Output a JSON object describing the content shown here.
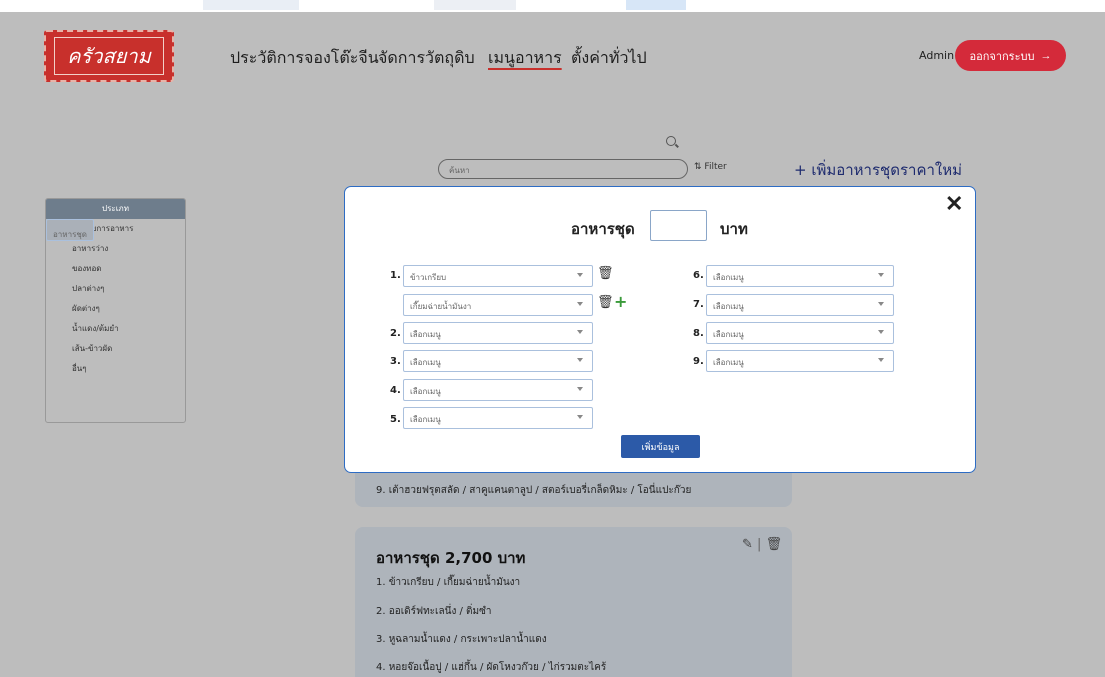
{
  "header": {
    "logo_text": "ครัวสยาม",
    "nav": [
      "ประวัติการจองโต๊ะจีน",
      "จัดการวัตถุดิบ",
      "เมนูอาหาร",
      "ตั้งค่าทั่วไป"
    ],
    "admin_label": "Admin",
    "logout_label": "ออกจากระบบ",
    "logout_arrow": "→"
  },
  "search": {
    "placeholder": "ค้นหา",
    "filter_label": "Filter",
    "filter_icon": "⇅"
  },
  "add_set_label": "+ เพิ่มอาหารชุดราคาใหม่",
  "sidebar": {
    "header": "ประเภท",
    "items": [
      "อาหารชุด",
      "ประเภทรายการอาหาร",
      "อาหารว่าง",
      "ของทอด",
      "ปลาต่างๆ",
      "ผัดต่างๆ",
      "น้ำแดง/ต้มยำ",
      "เส้น-ข้าวผัด",
      "อื่นๆ"
    ]
  },
  "modal": {
    "title": "อาหารชุด",
    "unit": "บาท",
    "close_icon": "✕",
    "left_rows": [
      {
        "num": "1.",
        "value": "ข้าวเกรียบ"
      },
      {
        "num": "",
        "value": "เกี๊ยมฉ่ายน้ำมันงา"
      },
      {
        "num": "2.",
        "value": "เลือกเมนู"
      },
      {
        "num": "3.",
        "value": "เลือกเมนู"
      },
      {
        "num": "4.",
        "value": "เลือกเมนู"
      },
      {
        "num": "5.",
        "value": "เลือกเมนู"
      }
    ],
    "right_rows": [
      {
        "num": "6.",
        "value": "เลือกเมนู"
      },
      {
        "num": "7.",
        "value": "เลือกเมนู"
      },
      {
        "num": "8.",
        "value": "เลือกเมนู"
      },
      {
        "num": "9.",
        "value": "เลือกเมนู"
      }
    ],
    "trash_icon": "🗑",
    "plus_icon": "+",
    "submit_label": "เพิ่มข้อมูล"
  },
  "card_prev": {
    "line9": "9. เต้าฮวยฟรุตสลัด / สาคูแคนตาลูป / สตอร์เบอรี่เกล็ดหิมะ / โอนี่แปะก๊วย"
  },
  "card": {
    "title": "อาหารชุด 2,700 บาท",
    "edit_icon": "✎",
    "trash_icon": "🗑",
    "lines": [
      "1. ข้าวเกรียบ / เกี๊ยมฉ่ายน้ำมันงา",
      "2. ออเดิร์ฟทะเลนึ่ง / ติ่มซำ",
      "3. หูฉลามน้ำแดง / กระเพาะปลาน้ำแดง",
      "4. หอยจ๊อเนื้อปู / แฮ่กึ้น / ผัดโหงวก๊วย / ไก่รวมตะไคร้"
    ]
  }
}
